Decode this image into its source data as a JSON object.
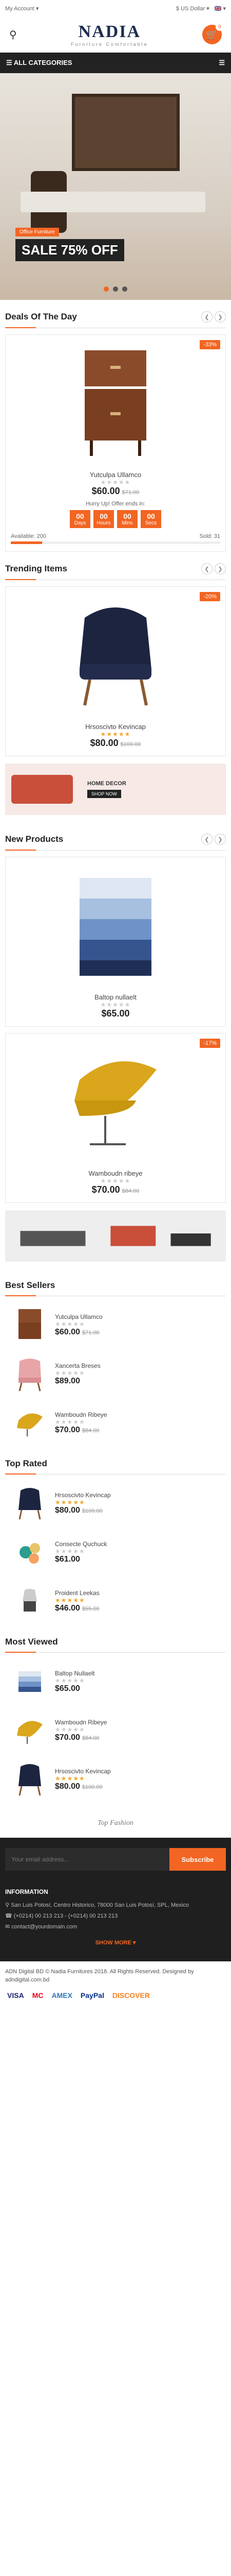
{
  "topbar": {
    "account": "My Account ▾",
    "currency": "$ US Dollar ▾",
    "lang": "🇬🇧 ▾"
  },
  "header": {
    "logo": "NADIA",
    "tagline": "Furniture Comfortable",
    "cart_count": "0"
  },
  "catbar": {
    "label": "ALL CATEGORIES"
  },
  "hero": {
    "tag": "Office Furniture",
    "sale": "SALE 75% OFF"
  },
  "deals": {
    "title": "Deals Of The Day",
    "badge": "-33%",
    "name": "Yutculpa Ullamco",
    "price": "$60.00",
    "old": "$71.00",
    "hurry": "Hurry Up! Offer ends in:",
    "cd": [
      {
        "n": "00",
        "l": "Days"
      },
      {
        "n": "00",
        "l": "Hours"
      },
      {
        "n": "00",
        "l": "Mins"
      },
      {
        "n": "00",
        "l": "Secs"
      }
    ],
    "available": "Available: 200",
    "sold": "Sold: 31",
    "sold_fraction": 0.15
  },
  "trending": {
    "title": "Trending Items",
    "badge": "-20%",
    "name": "Hrsoscivto Kevincap",
    "price": "$80.00",
    "old": "$100.00"
  },
  "banner1": {
    "text": "HOME DECOR",
    "btn": "SHOP NOW"
  },
  "newp": {
    "title": "New Products",
    "p1": {
      "name": "Baltop nullaelt",
      "price": "$65.00"
    },
    "p2": {
      "badge": "-17%",
      "name": "Wamboudn ribeye",
      "price": "$70.00",
      "old": "$84.00"
    }
  },
  "best": {
    "title": "Best Sellers",
    "items": [
      {
        "name": "Yutculpa Ullamco",
        "price": "$60.00",
        "old": "$71.00"
      },
      {
        "name": "Xancerta Breses",
        "price": "$89.00",
        "old": ""
      },
      {
        "name": "Wamboudn Ribeye",
        "price": "$70.00",
        "old": "$84.00"
      }
    ]
  },
  "toprated": {
    "title": "Top Rated",
    "items": [
      {
        "name": "Hrsoscivto Kevincap",
        "price": "$80.00",
        "old": "$100.00"
      },
      {
        "name": "Consecte Quchuck",
        "price": "$61.00",
        "old": ""
      },
      {
        "name": "Proident Leekas",
        "price": "$46.00",
        "old": "$55.00"
      }
    ]
  },
  "mostviewed": {
    "title": "Most Viewed",
    "items": [
      {
        "name": "Baltop Nullaelt",
        "price": "$65.00",
        "old": ""
      },
      {
        "name": "Wamboudn Ribeye",
        "price": "$70.00",
        "old": "$84.00"
      },
      {
        "name": "Hrsoscivto Kevincap",
        "price": "$80.00",
        "old": "$100.00"
      }
    ]
  },
  "tf": {
    "text": "Top Fashion"
  },
  "footer": {
    "placeholder": "Your email address...",
    "subscribe": "Subscribe",
    "info": "INFORMATION",
    "addr": "San Luis Potosí, Centro Historico, 78000 San Luis Potosí, SPL, Mexico",
    "phone": "(+0214) 00 213 213 - (+0214) 00 213 213",
    "email": "contact@yourdomain.com",
    "showmore": "SHOW MORE ▾"
  },
  "copy": {
    "line1": "ADN Digital BD © Nadia Furnitures 2018. All Rights Reserved. Designed by adndigital.com.bd"
  },
  "pays": [
    "VISA",
    "MC",
    "AMEX",
    "PayPal",
    "DISCOVER"
  ]
}
